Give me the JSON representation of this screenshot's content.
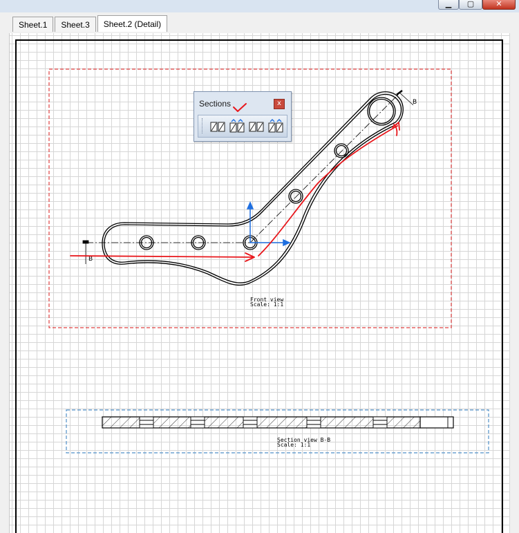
{
  "window": {
    "buttons": {
      "minimize": "▁",
      "maximize": "▢",
      "close": "✕"
    }
  },
  "tabs": [
    {
      "label": "Sheet.1",
      "active": false
    },
    {
      "label": "Sheet.3",
      "active": false
    },
    {
      "label": "Sheet.2 (Detail)",
      "active": true
    }
  ],
  "sections_toolbar": {
    "title": "Sections",
    "close_label": "x",
    "tools": [
      {
        "icon": "offset-section-view-icon"
      },
      {
        "icon": "aligned-section-view-icon"
      },
      {
        "icon": "offset-section-cut-icon"
      },
      {
        "icon": "aligned-section-cut-icon"
      }
    ]
  },
  "drawing": {
    "front_view": {
      "title": "Front view",
      "scale": "Scale: 1:1"
    },
    "section_view": {
      "title": "Section view B-B",
      "scale": "Scale: 1:1"
    },
    "cut_label_start": "B",
    "cut_label_end": "B"
  },
  "colors": {
    "frame_red": "#e04040",
    "frame_blue": "#4f8fc8",
    "annotation_red": "#e8161b",
    "axis_blue": "#1f6fe0"
  }
}
